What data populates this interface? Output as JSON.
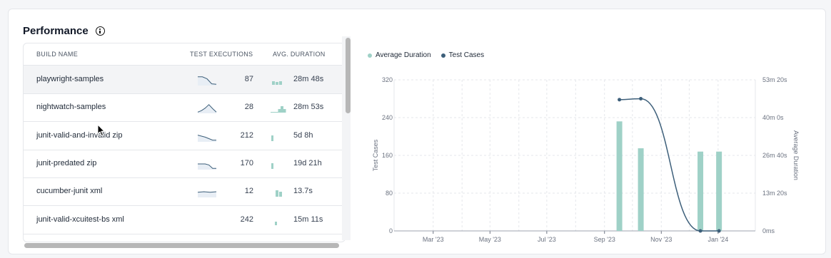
{
  "panel": {
    "title": "Performance"
  },
  "table": {
    "headers": {
      "build_name": "BUILD NAME",
      "test_executions": "TEST EXECUTIONS",
      "avg_duration": "AVG. DURATION"
    },
    "rows": [
      {
        "name": "playwright-samples",
        "executions": "87",
        "duration": "28m 48s",
        "selected": true
      },
      {
        "name": "nightwatch-samples",
        "executions": "28",
        "duration": "28m 53s",
        "selected": false
      },
      {
        "name": "junit-valid-and-invalid zip",
        "executions": "212",
        "duration": "5d 8h",
        "selected": false
      },
      {
        "name": "junit-predated zip",
        "executions": "170",
        "duration": "19d 21h",
        "selected": false
      },
      {
        "name": "cucumber-junit xml",
        "executions": "12",
        "duration": "13.7s",
        "selected": false
      },
      {
        "name": "junit-valid-xcuitest-bs xml",
        "executions": "242",
        "duration": "15m 11s",
        "selected": false
      }
    ]
  },
  "colors": {
    "bar": "#9fd1c7",
    "line": "#3d5f7a",
    "grid": "#e5e7eb",
    "axis": "#6b7280"
  },
  "chart_data": {
    "type": "bar",
    "legend": [
      "Average Duration",
      "Test Cases"
    ],
    "legend_position": "top-left",
    "x_ticks": [
      "Mar '23",
      "May '23",
      "Jul '23",
      "Sep '23",
      "Nov '23",
      "Jan '24"
    ],
    "y_left": {
      "label": "Test Cases",
      "ticks": [
        "0",
        "80",
        "160",
        "240",
        "320"
      ],
      "range": [
        0,
        320
      ]
    },
    "y_right": {
      "label": "Average Duration",
      "ticks": [
        "0ms",
        "13m 20s",
        "26m 40s",
        "40m 0s",
        "53m 20s"
      ],
      "range_seconds": [
        0,
        3200
      ]
    },
    "grid": true,
    "series": [
      {
        "name": "Test Cases",
        "type": "bar",
        "axis": "left",
        "points": [
          {
            "x": "2023-10-01",
            "y": 232
          },
          {
            "x": "2023-10-24",
            "y": 175
          },
          {
            "x": "2023-12-27",
            "y": 168
          },
          {
            "x": "2024-01-16",
            "y": 168
          }
        ]
      },
      {
        "name": "Average Duration",
        "type": "line",
        "axis": "right",
        "unit": "seconds",
        "points": [
          {
            "x": "2023-10-01",
            "y": 2780
          },
          {
            "x": "2023-10-24",
            "y": 2800
          },
          {
            "x": "2023-12-27",
            "y": 0
          },
          {
            "x": "2024-01-16",
            "y": 0
          }
        ]
      }
    ]
  },
  "sparklines": [
    {
      "exec": [
        0.2,
        0.2,
        0.4,
        0.9,
        0.95
      ],
      "dur": [
        0.5,
        0.4,
        0.5
      ]
    },
    {
      "exec": [
        0.95,
        0.8,
        0.55,
        0.2,
        0.6,
        0.95
      ],
      "dur": [
        0.05,
        0.05,
        0.05,
        0.5,
        0.9,
        0.5
      ]
    },
    {
      "exec": [
        0.4,
        0.5,
        0.6,
        0.75,
        0.9,
        0.9
      ],
      "dur": [
        0.8
      ]
    },
    {
      "exec": [
        0.5,
        0.5,
        0.5,
        0.6,
        0.95,
        0.95
      ],
      "dur": [
        0.8
      ]
    },
    {
      "exec": [
        0.55,
        0.5,
        0.55,
        0.5
      ],
      "dur": [
        0.9,
        0.7
      ]
    },
    {
      "exec": [],
      "dur": [
        0.7
      ]
    }
  ]
}
